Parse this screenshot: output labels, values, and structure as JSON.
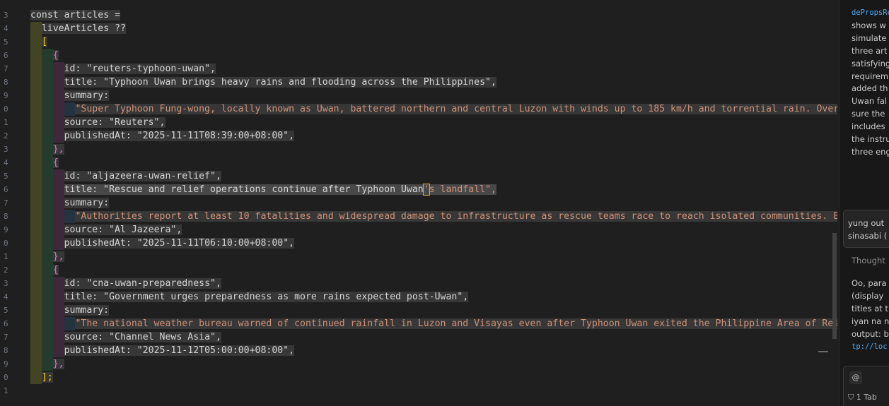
{
  "editor": {
    "line_numbers": [
      "3",
      "4",
      "5",
      "6",
      "7",
      "8",
      "9",
      "0",
      "1",
      "2",
      "3",
      "4",
      "5",
      "6",
      "7",
      "8",
      "9",
      "0",
      "1",
      "2",
      "3",
      "4",
      "5",
      "6",
      "7",
      "8",
      "9",
      "0",
      "1"
    ],
    "code": {
      "l3": "const articles =",
      "l4": "liveArticles ??",
      "l5": "[",
      "l6": "{",
      "l7": "id: \"reuters-typhoon-uwan\",",
      "l8": "title: \"Typhoon Uwan brings heavy rains and flooding across the Philippines\",",
      "l9": "summary:",
      "l10": "\"Super Typhoon Fung-wong, locally known as Uwan, battered northern and central Luzon with winds up to 185 km/h and torrential rain. Over t",
      "l11": "source: \"Reuters\",",
      "l12": "publishedAt: \"2025-11-11T08:39:00+08:00\",",
      "l13": "},",
      "l14": "{",
      "l15": "id: \"aljazeera-uwan-relief\",",
      "l16a": "title: \"Rescue and relief operations continue after Typhoon Uwan",
      "l16b": "'",
      "l16c": "s landfall\",",
      "l17": "summary:",
      "l18": "\"Authorities report at least 10 fatalities and widespread damage to infrastructure as rescue teams race to reach isolated communities. Eme",
      "l19": "source: \"Al Jazeera\",",
      "l20": "publishedAt: \"2025-11-11T06:10:00+08:00\",",
      "l21": "},",
      "l22": "{",
      "l23": "id: \"cna-uwan-preparedness\",",
      "l24": "title: \"Government urges preparedness as more rains expected post-Uwan\",",
      "l25": "summary:",
      "l26": "\"The national weather bureau warned of continued rainfall in Luzon and Visayas even after Typhoon Uwan exited the Philippine Area of Respo",
      "l27": "source: \"Channel News Asia\",",
      "l28": "publishedAt: \"2025-11-12T05:00:00+08:00\",",
      "l29": "},",
      "l30": "];"
    }
  },
  "chat": {
    "assistant_lines": [
      "dePropsRev",
      "shows w",
      "simulate",
      "three art",
      "satisfying",
      "requirem",
      "added th",
      "Uwan fal",
      "sure the",
      "includes",
      "the instru",
      "three eng"
    ],
    "user_message_lines": [
      "yung out",
      "sinasabi ("
    ],
    "thought_label": "Thought",
    "reply_lines": [
      "Oo, para",
      "(display",
      "titles at t",
      "iyan na n",
      "output: b"
    ],
    "reply_code": "tp://loc",
    "input": {
      "at_symbol": "@",
      "tab_chip": "1 Tab"
    }
  },
  "colors": {
    "editor_bg": "#1f1f1f",
    "string": "#ce9178",
    "bracket_yellow": "#ffd700",
    "bracket_purple": "#da70d6",
    "bracket_blue": "#179fff",
    "cursor_orange": "#e8a33d"
  },
  "icons": [
    "at-icon",
    "pin-icon"
  ]
}
